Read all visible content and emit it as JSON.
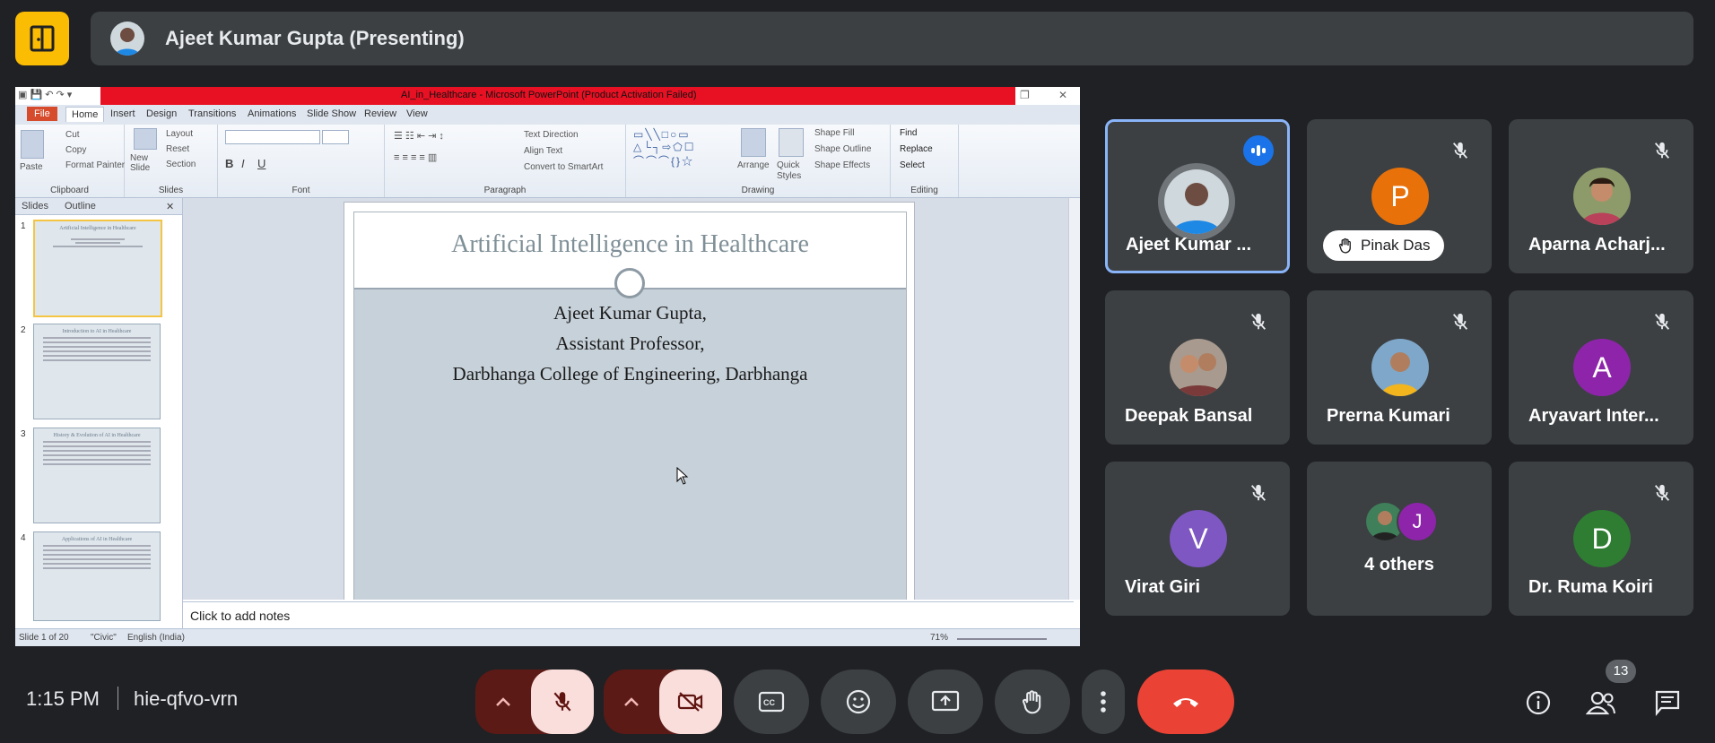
{
  "meeting": {
    "presenter_label": "Ajeet Kumar Gupta (Presenting)",
    "time": "1:15 PM",
    "code": "hie-qfvo-vrn",
    "participant_count": "13"
  },
  "ppt": {
    "window_title": "AI_in_Healthcare - Microsoft PowerPoint (Product Activation Failed)",
    "tabs": [
      "File",
      "Home",
      "Insert",
      "Design",
      "Transitions",
      "Animations",
      "Slide Show",
      "Review",
      "View"
    ],
    "groups": [
      "Clipboard",
      "Slides",
      "Font",
      "Paragraph",
      "Drawing",
      "Editing"
    ],
    "clipboard_items": [
      "Paste",
      "Cut",
      "Copy",
      "Format Painter"
    ],
    "slides_items": [
      "New Slide",
      "Layout",
      "Reset",
      "Section"
    ],
    "paragraph_items": [
      "Text Direction",
      "Align Text",
      "Convert to SmartArt"
    ],
    "drawing_items": [
      "Arrange",
      "Quick Styles",
      "Shape Fill",
      "Shape Outline",
      "Shape Effects"
    ],
    "editing_items": [
      "Find",
      "Replace",
      "Select"
    ],
    "pane_tabs": [
      "Slides",
      "Outline"
    ],
    "thumbnails": [
      {
        "num": "1",
        "title": "Artificial Intelligence in Healthcare"
      },
      {
        "num": "2",
        "title": "Introduction to AI in Healthcare"
      },
      {
        "num": "3",
        "title": "History & Evolution of AI in Healthcare"
      },
      {
        "num": "4",
        "title": "Applications of AI in Healthcare"
      }
    ],
    "slide": {
      "title": "Artificial Intelligence in Healthcare",
      "lines": [
        "Ajeet Kumar Gupta,",
        "Assistant Professor,",
        "Darbhanga College of Engineering, Darbhanga"
      ]
    },
    "notes_placeholder": "Click to add notes",
    "status": {
      "slide_info": "Slide 1 of 20",
      "theme": "\"Civic\"",
      "language": "English (India)",
      "zoom": "71%"
    }
  },
  "participants": [
    {
      "name": "Ajeet Kumar ...",
      "initial": "",
      "color": "",
      "muted": false,
      "speaking": true
    },
    {
      "name": "Pinak Das",
      "initial": "P",
      "color": "#e8710a",
      "muted": true,
      "hand_raised": true
    },
    {
      "name": "Aparna Acharj...",
      "initial": "",
      "color": "",
      "muted": true
    },
    {
      "name": "Deepak Bansal",
      "initial": "",
      "color": "",
      "muted": true
    },
    {
      "name": "Prerna Kumari",
      "initial": "",
      "color": "",
      "muted": true
    },
    {
      "name": "Aryavart Inter...",
      "initial": "A",
      "color": "#8e24aa",
      "muted": true
    },
    {
      "name": "Virat Giri",
      "initial": "V",
      "color": "#7e57c2",
      "muted": true
    },
    {
      "name": "4 others",
      "initial": "J",
      "color": "#8e24aa",
      "muted": false
    },
    {
      "name": "Dr. Ruma Koiri",
      "initial": "D",
      "color": "#2e7d32",
      "muted": true
    }
  ],
  "controls": {
    "mic_state": "off",
    "camera_state": "off",
    "end_call_color": "#ea4335"
  }
}
